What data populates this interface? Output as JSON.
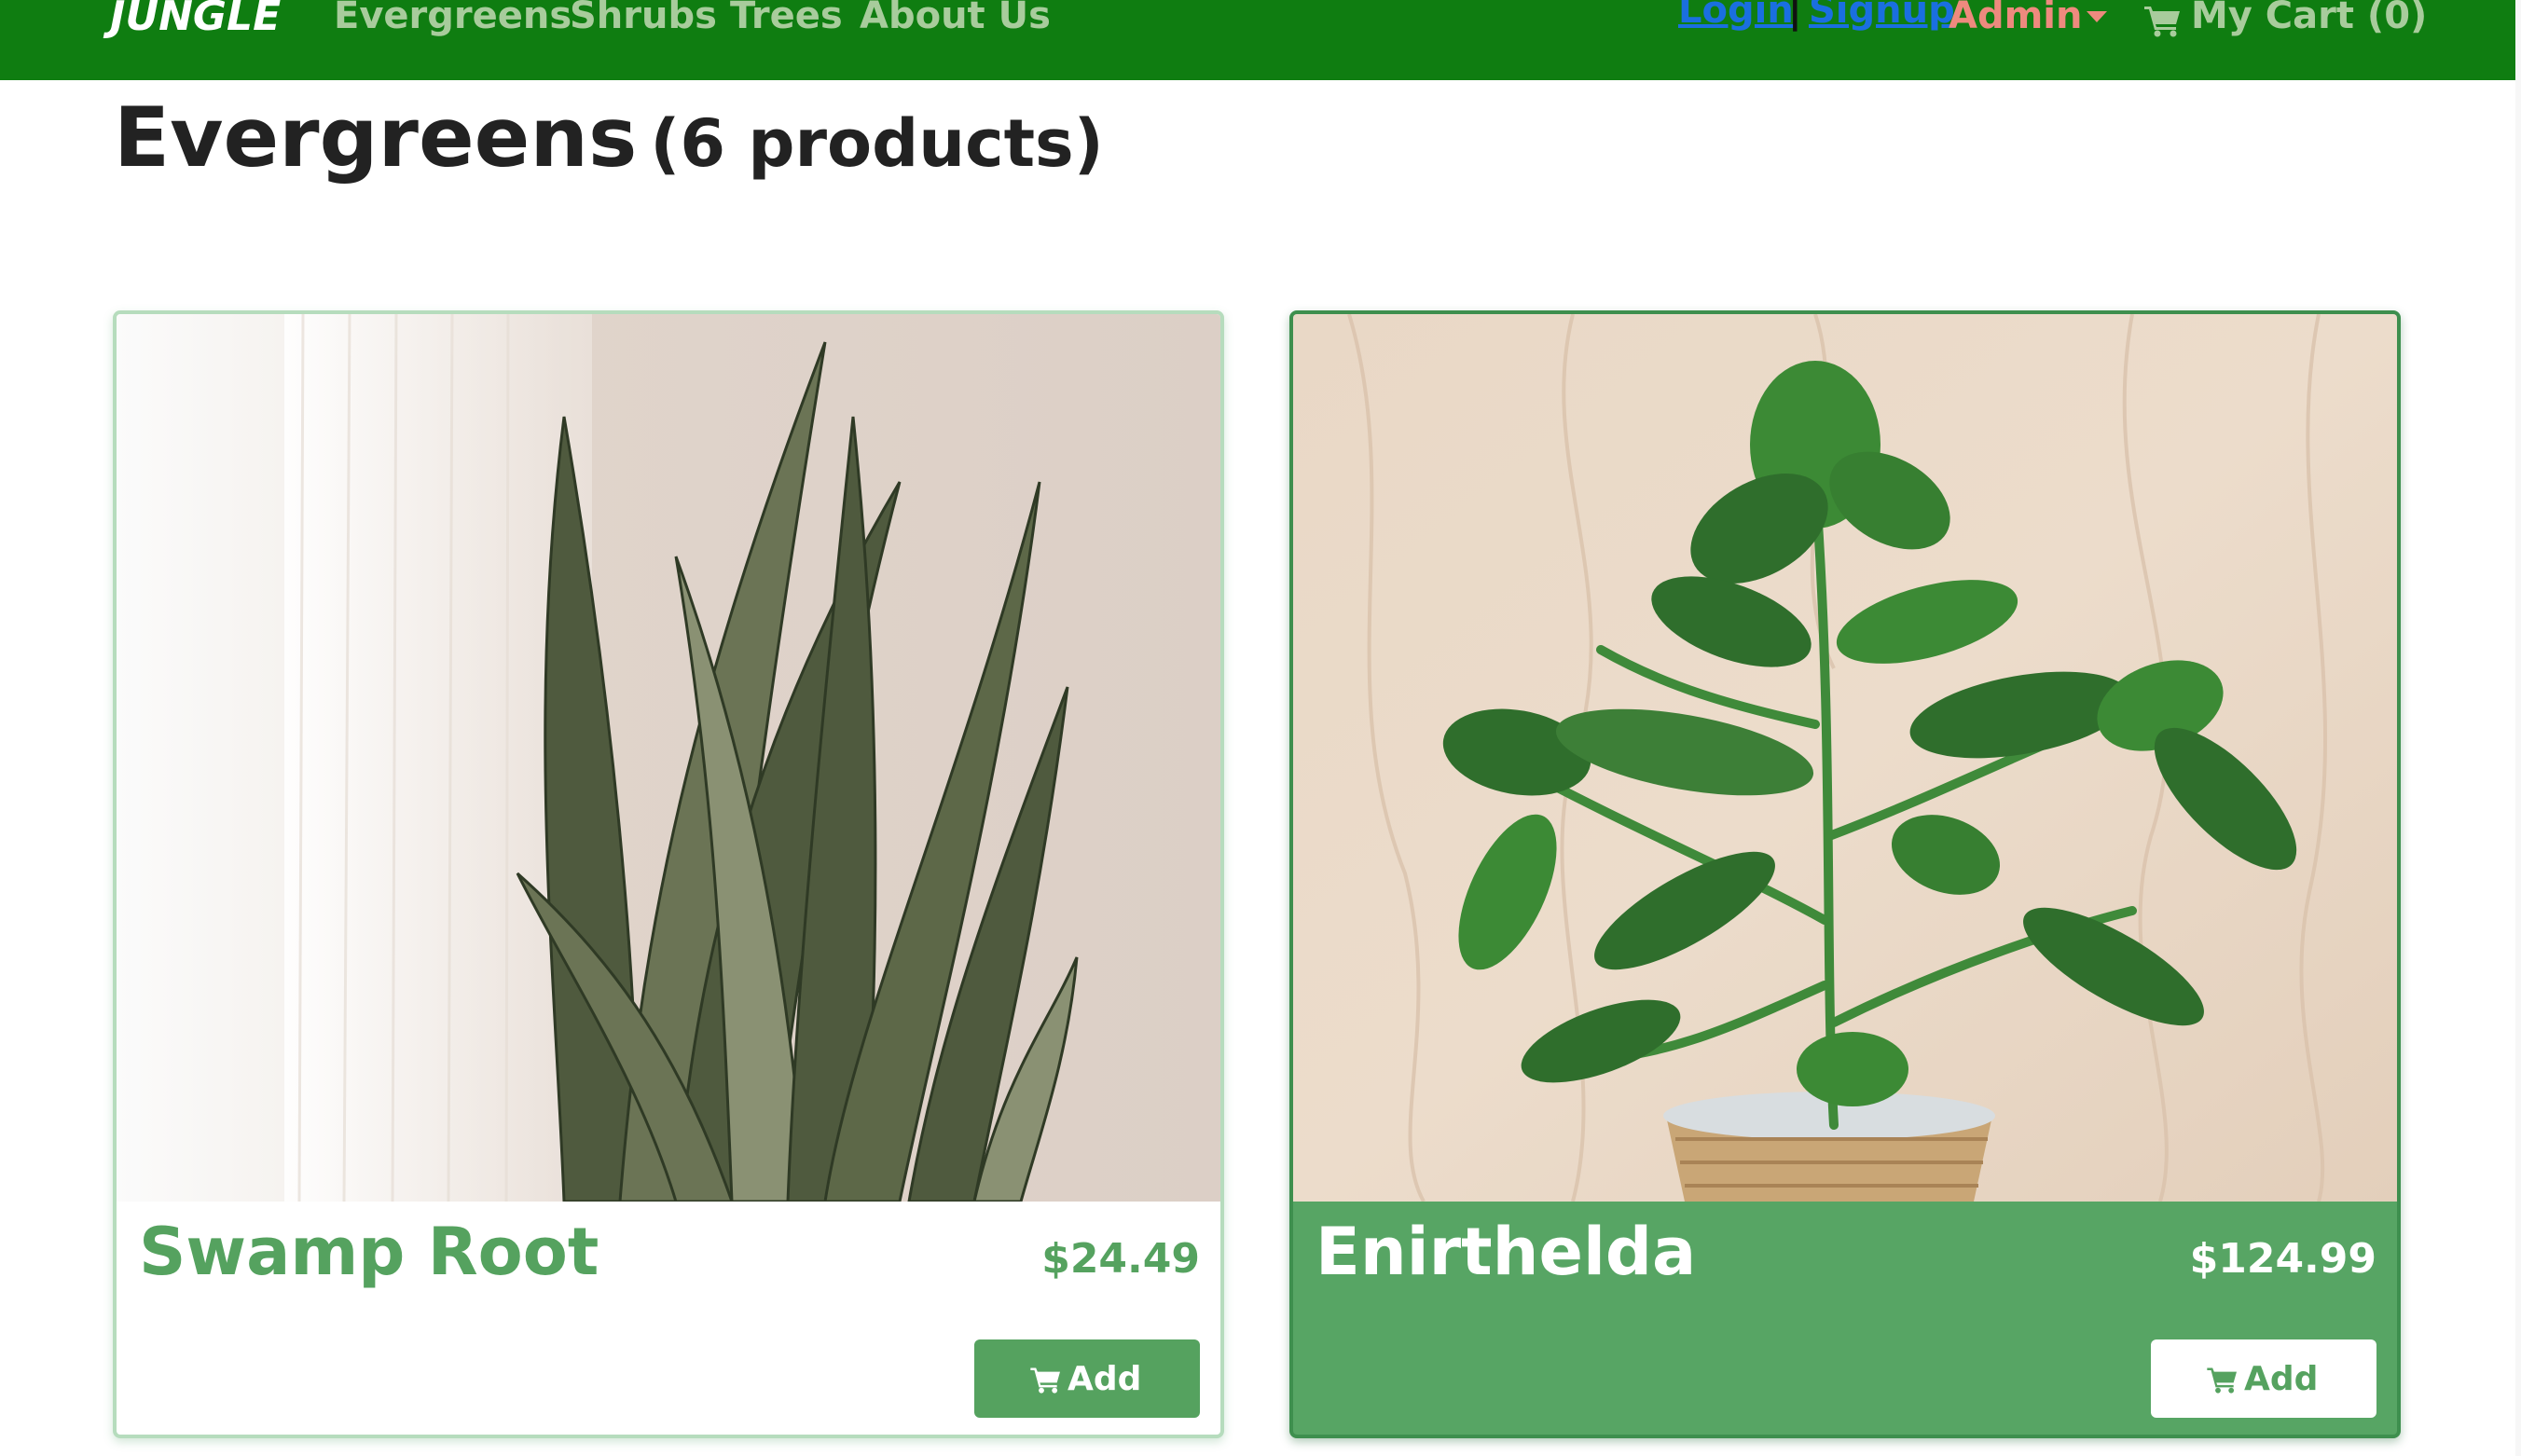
{
  "navbar": {
    "brand": "JUNGLE",
    "links": [
      "Evergreens",
      "Shrubs",
      "Trees",
      "About Us"
    ],
    "login": "Login",
    "separator": "|",
    "signup": "Signup",
    "admin": "Admin",
    "cart_label": "My Cart (0)",
    "cart_icon": "shopping-cart-icon",
    "caret_icon": "caret-down-icon"
  },
  "heading": {
    "title": "Evergreens",
    "count": "(6 products)"
  },
  "products": [
    {
      "name": "Swamp Root",
      "price": "$24.49",
      "button_label": "Add",
      "button_icon": "shopping-cart-icon",
      "image": "snake-plant-photo"
    },
    {
      "name": "Enirthelda",
      "price": "$124.99",
      "button_label": "Add",
      "button_icon": "shopping-cart-icon",
      "image": "potted-plant-photo"
    }
  ],
  "colors": {
    "navbar_bg": "#0f7d11",
    "nav_link": "#a8cc9c",
    "auth_link": "#1a6fe0",
    "admin": "#ee8a7e",
    "accent_green": "#55a25f",
    "heading_text": "#222222"
  }
}
